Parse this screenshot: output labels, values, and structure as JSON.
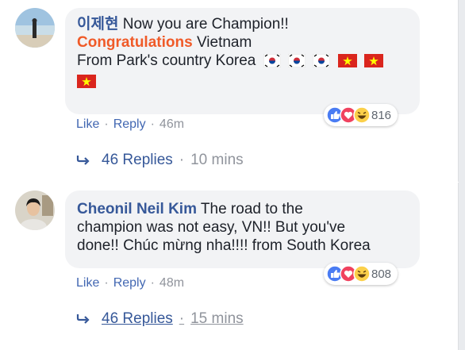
{
  "comments": [
    {
      "author": "이제현",
      "lines": [
        "Now you are Champion!!"
      ],
      "congrats": "Congratulations",
      "congrats_rest": " Vietnam",
      "line3": "From Park's country Korea",
      "reaction_count": "816",
      "like": "Like",
      "reply": "Reply",
      "time": "46m",
      "replies_label": "46 Replies",
      "replies_time": "10 mins"
    },
    {
      "author": "Cheonil Neil Kim",
      "text_line1": " The road to the",
      "text_line2": "champion was not easy, VN!! But you've",
      "text_line3": "done!! Chúc mừng nha!!!! from South Korea",
      "reaction_count": "808",
      "like": "Like",
      "reply": "Reply",
      "time": "48m",
      "replies_label": "46 Replies",
      "replies_time": "15 mins"
    }
  ],
  "separator": "·",
  "colors": {
    "link": "#365899",
    "congrats": "#f05a28",
    "bubble": "#f2f3f5",
    "vn_flag": "#da251d"
  }
}
